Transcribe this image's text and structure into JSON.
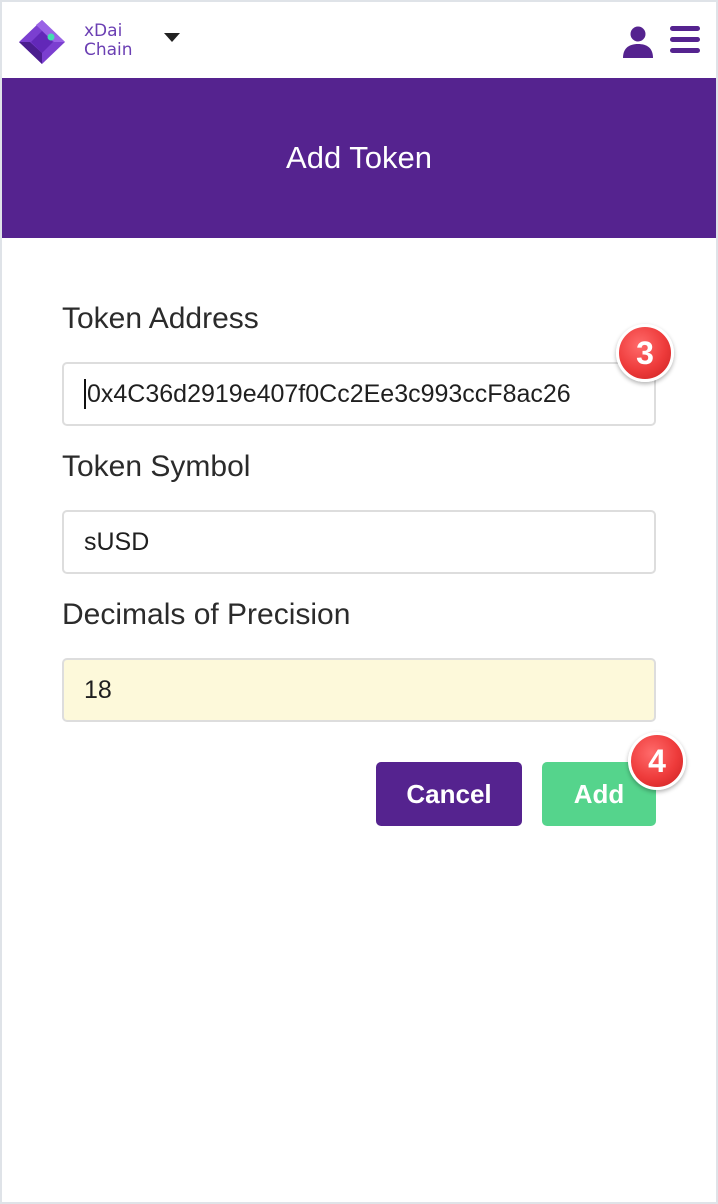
{
  "header": {
    "network_line1": "xDai",
    "network_line2": "Chain"
  },
  "banner": {
    "title": "Add Token"
  },
  "form": {
    "token_address_label": "Token Address",
    "token_address_value": "0x4C36d2919e407f0Cc2Ee3c993ccF8ac26",
    "token_symbol_label": "Token Symbol",
    "token_symbol_value": "sUSD",
    "decimals_label": "Decimals of Precision",
    "decimals_value": "18"
  },
  "buttons": {
    "cancel_label": "Cancel",
    "add_label": "Add"
  },
  "annotations": {
    "step_3": "3",
    "step_4": "4"
  },
  "colors": {
    "brand_purple": "#55238f",
    "add_green": "#55d48c",
    "badge_red": "#ee3b3b",
    "autofill_yellow": "#fdf9da"
  },
  "icons": [
    "wallet-logo-icon",
    "caret-down-icon",
    "account-icon",
    "hamburger-menu-icon"
  ]
}
